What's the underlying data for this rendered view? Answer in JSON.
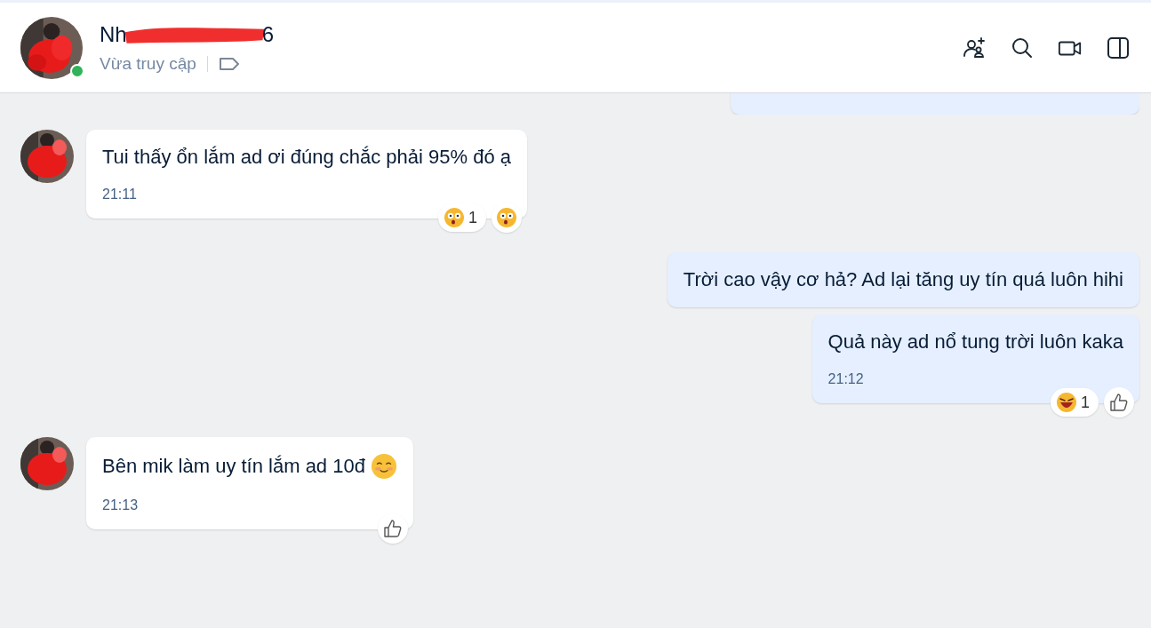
{
  "header": {
    "name_start": "Nh",
    "name_end": "6",
    "online": true,
    "status": "Vừa truy cập"
  },
  "messages": [
    {
      "kind": "outgoing",
      "cut_off": true
    },
    {
      "kind": "incoming",
      "text": "Tui thấy ổn lắm ad ơi đúng chắc phải 95% đó ạ",
      "time": "21:11",
      "reactions": [
        {
          "kind": "surprised",
          "count": "1"
        }
      ],
      "react_button": {
        "kind": "surprised"
      }
    },
    {
      "kind": "outgoing",
      "text": "Trời cao vậy cơ hả? Ad lại tăng uy tín quá luôn hihi"
    },
    {
      "kind": "outgoing",
      "text": "Quả này ad nổ tung trời luôn kaka",
      "time": "21:12",
      "reactions": [
        {
          "kind": "laughing",
          "count": "1"
        }
      ],
      "react_button": {
        "kind": "like"
      }
    },
    {
      "kind": "incoming",
      "text": "Bên mik làm uy tín lắm ad 10đ",
      "emoji": {
        "kind": "smiling"
      },
      "time": "21:13",
      "react_button": {
        "kind": "like"
      }
    }
  ]
}
